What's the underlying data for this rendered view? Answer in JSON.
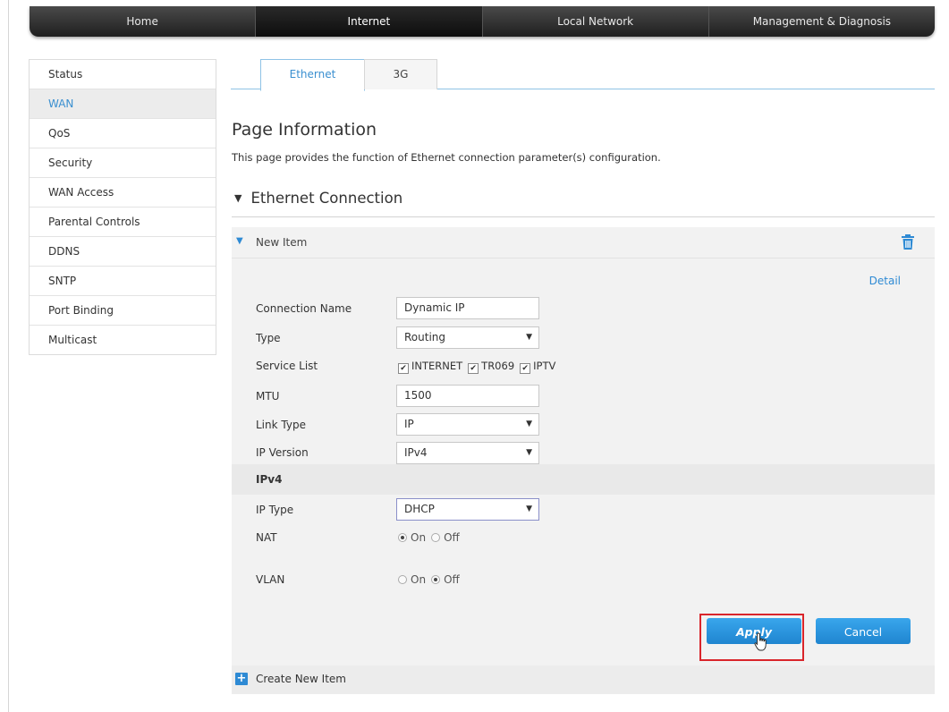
{
  "topnav": [
    {
      "label": "Home",
      "active": false
    },
    {
      "label": "Internet",
      "active": true
    },
    {
      "label": "Local Network",
      "active": false
    },
    {
      "label": "Management & Diagnosis",
      "active": false
    }
  ],
  "sidebar": [
    {
      "label": "Status"
    },
    {
      "label": "WAN"
    },
    {
      "label": "QoS"
    },
    {
      "label": "Security"
    },
    {
      "label": "WAN Access"
    },
    {
      "label": "Parental Controls"
    },
    {
      "label": "DDNS"
    },
    {
      "label": "SNTP"
    },
    {
      "label": "Port Binding"
    },
    {
      "label": "Multicast"
    }
  ],
  "tabs": [
    {
      "label": "Ethernet"
    },
    {
      "label": "3G"
    }
  ],
  "page": {
    "title": "Page Information",
    "description": "This page provides the function of Ethernet connection parameter(s) configuration."
  },
  "section": {
    "title": "Ethernet Connection"
  },
  "item": {
    "title": "New Item",
    "detail_link": "Detail",
    "connection_name": {
      "label": "Connection Name",
      "value": "Dynamic IP"
    },
    "type": {
      "label": "Type",
      "value": "Routing"
    },
    "service_list": {
      "label": "Service List",
      "options": [
        "INTERNET",
        "TR069",
        "IPTV"
      ]
    },
    "mtu": {
      "label": "MTU",
      "value": "1500"
    },
    "link_type": {
      "label": "Link Type",
      "value": "IP"
    },
    "ip_version": {
      "label": "IP Version",
      "value": "IPv4"
    },
    "ipv4_heading": "IPv4",
    "ip_type": {
      "label": "IP Type",
      "value": "DHCP"
    },
    "nat": {
      "label": "NAT",
      "on": "On",
      "off": "Off"
    },
    "vlan": {
      "label": "VLAN",
      "on": "On",
      "off": "Off"
    },
    "apply_label": "Apply",
    "cancel_label": "Cancel"
  },
  "create_new_item": "Create New Item",
  "colors": {
    "accent": "#2e8ad4",
    "highlight": "#d9252b"
  }
}
